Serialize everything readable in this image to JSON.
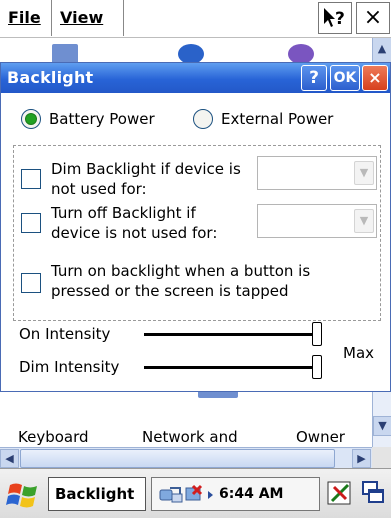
{
  "menubar": {
    "file_label": "File",
    "view_label": "View",
    "help_glyph": "?",
    "close_glyph": "×"
  },
  "dialog": {
    "title": "Backlight",
    "help_glyph": "?",
    "ok_label": "OK",
    "close_glyph": "×",
    "power_source": {
      "options": [
        "Battery Power",
        "External Power"
      ],
      "selected": "Battery Power"
    },
    "dim_option": {
      "label_line1": "Dim Backlight if device is",
      "label_line2": "not used for:",
      "checked": false,
      "dropdown_value": ""
    },
    "off_option": {
      "label_line1": "Turn off Backlight if",
      "label_line2": "device is not used for:",
      "checked": false,
      "dropdown_value": ""
    },
    "tap_option": {
      "label_line1": "Turn on backlight when a button is",
      "label_line2": "pressed or the screen is tapped",
      "checked": false
    },
    "on_intensity": {
      "label": "On Intensity",
      "level": 1.0
    },
    "dim_intensity": {
      "label": "Dim Intensity",
      "level": 1.0
    },
    "max_label": "Max"
  },
  "background": {
    "items": [
      "Keyboard",
      "Network and",
      "Owner"
    ]
  },
  "taskbar": {
    "window_button": "Backlight",
    "clock": "6:44 AM"
  },
  "colors": {
    "titlebar": "#2864d7",
    "radio_selected": "#21a121",
    "close_button": "#d7401e"
  },
  "icons": {
    "start": "windows-flag-icon",
    "tray": [
      "sync-icon",
      "network-status-icon"
    ],
    "taskbar_right": [
      "input-panel-icon",
      "window-switch-icon"
    ]
  }
}
